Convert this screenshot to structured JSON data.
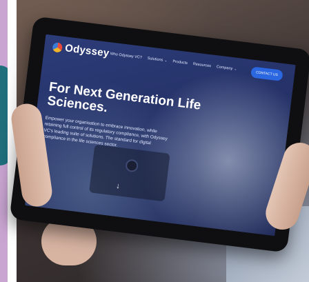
{
  "tablet_screen": {
    "logo": {
      "text": "Odyssey",
      "icon": "odyssey-logo-icon"
    },
    "nav": {
      "items": [
        {
          "label": "Who Odyssey VC?"
        },
        {
          "label": "Solutions",
          "has_dropdown": true
        },
        {
          "label": "Products"
        },
        {
          "label": "Resources"
        },
        {
          "label": "Company",
          "has_dropdown": true
        }
      ],
      "contact_button": "CONTACT US"
    },
    "hero": {
      "title": "For Next Generation Life Sciences.",
      "body": "Empower your organisation to embrace innovation, while retaining full control of its regulatory compliance, with Odyssey VC's leading suite of solutions. The standard for digital compliance in the life sciences sector.",
      "scroll_icon": "arrow-down-icon"
    }
  },
  "colors": {
    "screen_bg": "#26336a",
    "contact_button_bg": "#2b67e0",
    "left_strip": "#c9a6d2"
  }
}
